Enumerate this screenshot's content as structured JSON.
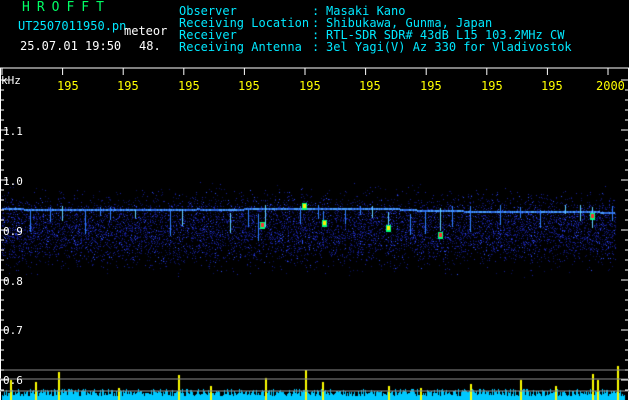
{
  "header": {
    "app_name": "HROFFT",
    "filename": "UT2507011950.pn",
    "detection_label": "meteor",
    "datetime": "25.07.01 19:50",
    "count": "48.",
    "info": [
      {
        "label": "Observer",
        "sep": ":",
        "value": "Masaki Kano"
      },
      {
        "label": "Receiving Location",
        "sep": ":",
        "value": "Shibukawa, Gunma, Japan"
      },
      {
        "label": "Receiver",
        "sep": ":",
        "value": "RTL-SDR SDR# 43dB L15 103.2MHz CW"
      },
      {
        "label": "Receiving Antenna",
        "sep": ":",
        "value": "3el Yagi(V) Az 330 for Vladivostok"
      }
    ]
  },
  "axes": {
    "y_unit": "kHz",
    "y_ticks": [
      "1.1",
      "1.0",
      "0.9",
      "0.8",
      "0.7",
      "0.6"
    ],
    "x_ticks": [
      "195",
      "195",
      "195",
      "195",
      "195",
      "195",
      "195",
      "195",
      "195",
      "2000"
    ]
  },
  "colors": {
    "time_labels": "#ffff00",
    "info_text": "#00e8ff",
    "title": "#00ff66",
    "spectrum_band": "#2030c0",
    "meteor_echo": "#ff3030",
    "level_graph": "#00e8ff"
  }
}
